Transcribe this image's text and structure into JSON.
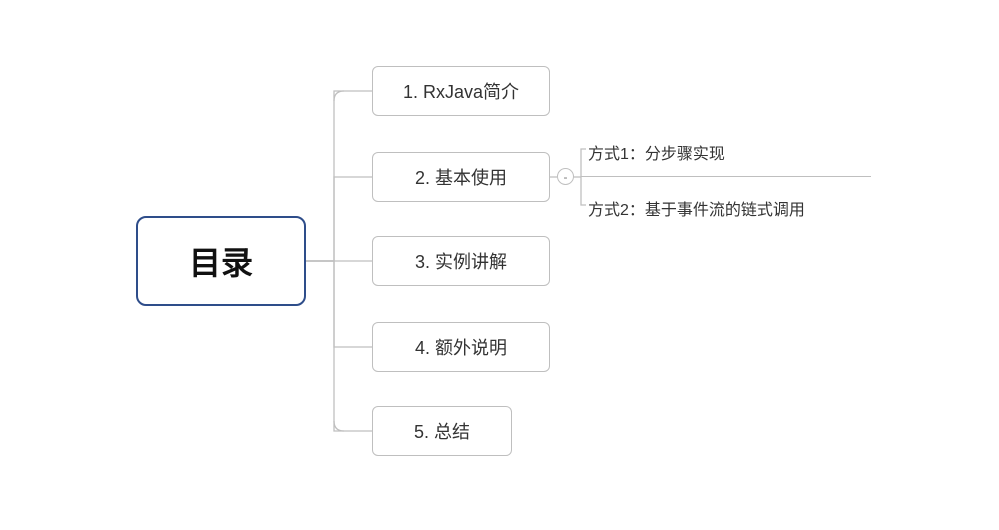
{
  "root": {
    "label": "目录"
  },
  "children": [
    {
      "label": "1. RxJava简介"
    },
    {
      "label": "2. 基本使用"
    },
    {
      "label": "3. 实例讲解"
    },
    {
      "label": "4. 额外说明"
    },
    {
      "label": "5. 总结"
    }
  ],
  "subs": [
    {
      "label": "方式1：分步骤实现"
    },
    {
      "label": "方式2：基于事件流的链式调用"
    }
  ],
  "collapseGlyph": "-"
}
